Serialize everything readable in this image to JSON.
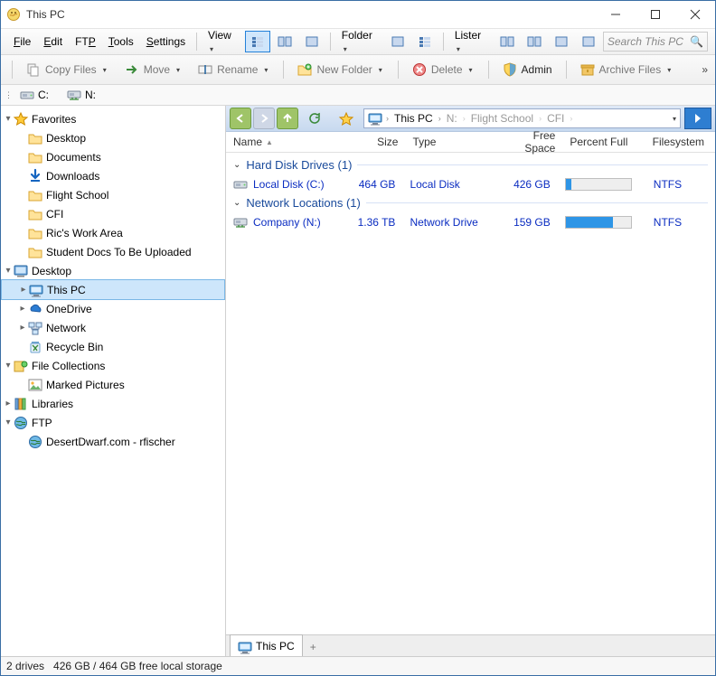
{
  "title": "This PC",
  "menu": {
    "file": "File",
    "edit": "Edit",
    "ftp": "FTP",
    "tools": "Tools",
    "settings": "Settings",
    "view": "View",
    "folder": "Folder",
    "lister": "Lister"
  },
  "search": {
    "placeholder": "Search This PC"
  },
  "toolbar2": {
    "copy": "Copy Files",
    "move": "Move",
    "rename": "Rename",
    "newfolder": "New Folder",
    "delete": "Delete",
    "admin": "Admin",
    "archive": "Archive Files",
    "more": "»"
  },
  "drivebar": {
    "c": "C:",
    "n": "N:"
  },
  "breadcrumb": {
    "root": "This PC",
    "items": [
      "N:",
      "Flight School",
      "CFI"
    ]
  },
  "columns": {
    "name": "Name",
    "size": "Size",
    "type": "Type",
    "free": "Free Space",
    "pct": "Percent Full",
    "fs": "Filesystem"
  },
  "groups": {
    "hdd": {
      "label": "Hard Disk Drives (1)"
    },
    "net": {
      "label": "Network Locations (1)"
    }
  },
  "drives": {
    "c": {
      "name": "Local Disk (C:)",
      "size": "464 GB",
      "type": "Local Disk",
      "free": "426 GB",
      "pct": 8,
      "fs": "NTFS"
    },
    "n": {
      "name": "Company (N:)",
      "size": "1.36 TB",
      "type": "Network Drive",
      "free": "159 GB",
      "pct": 73,
      "fs": "NTFS"
    }
  },
  "tree": {
    "favorites": "Favorites",
    "fav_items": [
      "Desktop",
      "Documents",
      "Downloads",
      "Flight School",
      "CFI",
      "Ric's Work Area",
      "Student Docs To Be Uploaded"
    ],
    "desktop": "Desktop",
    "thispc": "This PC",
    "onedrive": "OneDrive",
    "network": "Network",
    "recycle": "Recycle Bin",
    "filecol": "File Collections",
    "marked": "Marked Pictures",
    "libraries": "Libraries",
    "ftp": "FTP",
    "ftphost": "DesertDwarf.com - rfischer"
  },
  "tab": {
    "label": "This PC"
  },
  "status": {
    "count": "2 drives",
    "space": "426 GB / 464 GB free local storage"
  }
}
